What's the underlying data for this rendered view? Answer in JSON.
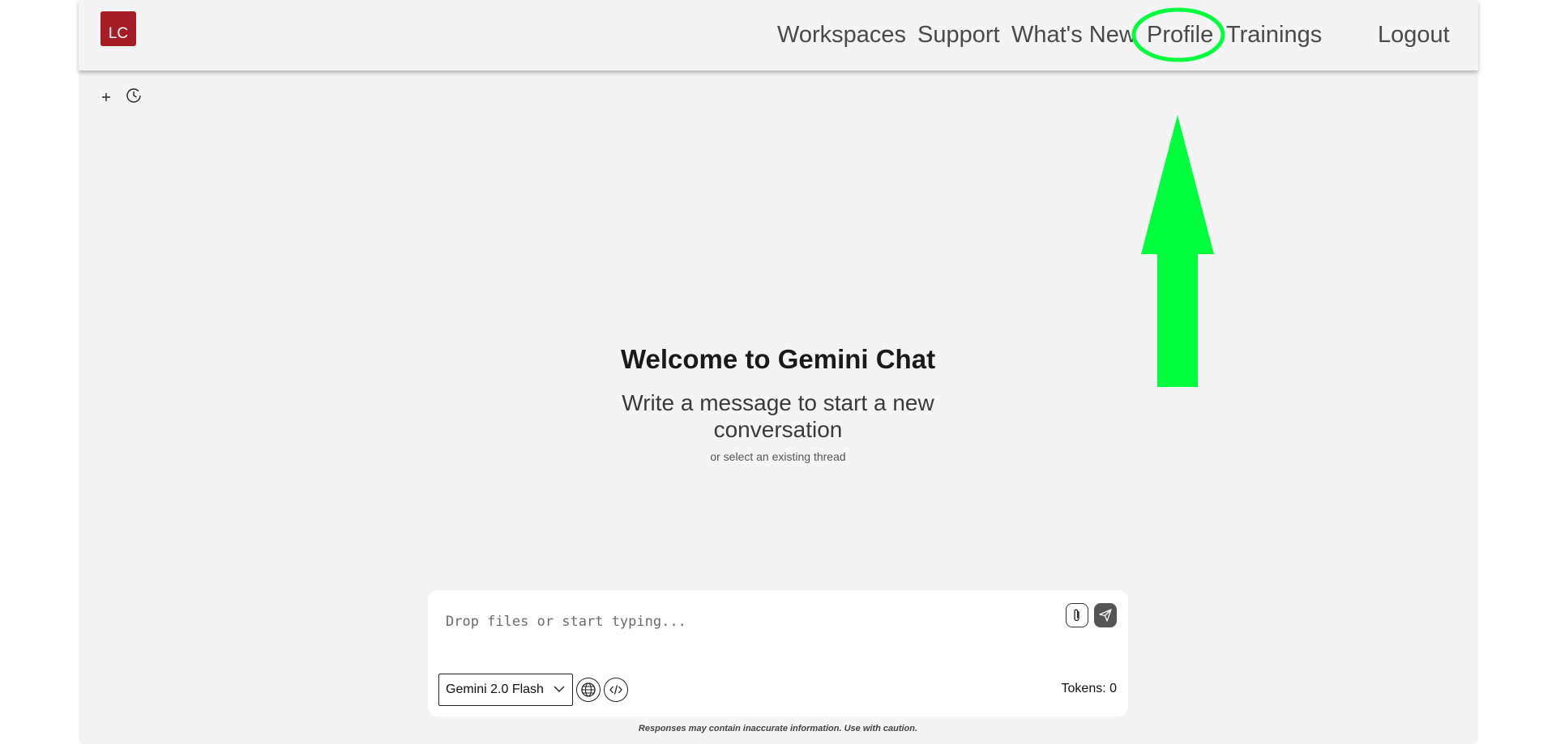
{
  "logo": {
    "text": "LC",
    "color": "#a51c24"
  },
  "nav": {
    "workspaces": "Workspaces",
    "support": "Support",
    "whats_new": "What's New",
    "profile": "Profile",
    "trainings": "Trainings",
    "logout": "Logout"
  },
  "toolbar": {
    "new_icon": "plus-icon",
    "history_icon": "clock-icon"
  },
  "welcome": {
    "title": "Welcome to Gemini Chat",
    "subtitle": "Write a message to start a new conversation",
    "small": "or select an existing thread"
  },
  "composer": {
    "placeholder": "Drop files or start typing...",
    "model": "Gemini 2.0 Flash",
    "tokens": "Tokens: 0",
    "attach_icon": "paperclip-icon",
    "send_icon": "send-icon",
    "web_icon": "globe-icon",
    "code_icon": "code-icon"
  },
  "disclaimer": "Responses may contain inaccurate information. Use with caution.",
  "annotation": {
    "color": "#00ff3c",
    "target": "Profile"
  }
}
